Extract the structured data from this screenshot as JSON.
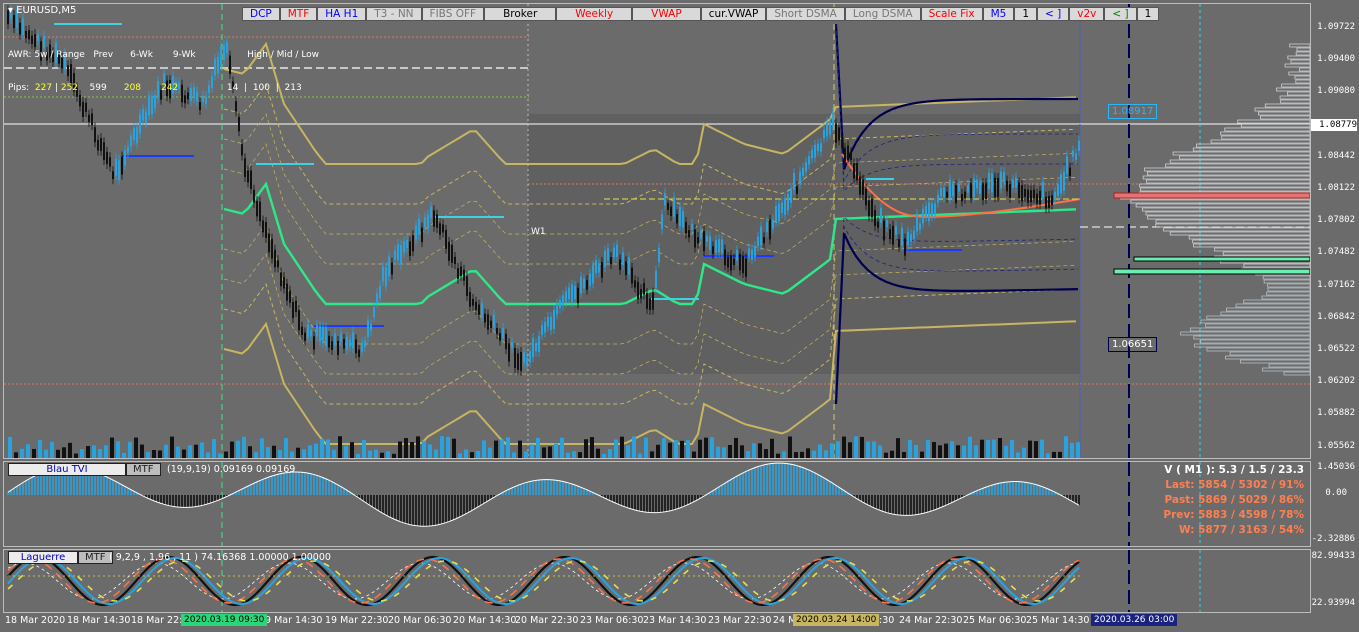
{
  "symbol": "EURUSD,M5",
  "toolbar": [
    {
      "label": "DCP",
      "color": "#0000ff"
    },
    {
      "label": "MTF",
      "color": "#ff0000"
    },
    {
      "label": "HA H1",
      "color": "#0000ff"
    },
    {
      "label": "T3 - NN",
      "color": "#777777"
    },
    {
      "label": "FIBS OFF",
      "color": "#777777"
    },
    {
      "label": "Broker",
      "color": "#000000"
    },
    {
      "label": "Weekly",
      "color": "#ff0000"
    },
    {
      "label": "VWAP",
      "color": "#ff0000"
    },
    {
      "label": "cur.VWAP",
      "color": "#000000"
    },
    {
      "label": "Short DSMA",
      "color": "#777777"
    },
    {
      "label": "Long DSMA",
      "color": "#777777"
    },
    {
      "label": "Scale Fix",
      "color": "#ff0000"
    },
    {
      "label": "M5",
      "color": "#0000ff"
    },
    {
      "label": "1",
      "color": "#000000"
    },
    {
      "label": "< ]",
      "color": "#0000ff"
    },
    {
      "label": "v2v",
      "color": "#ff0000"
    },
    {
      "label": "< ]",
      "color": "#008000"
    },
    {
      "label": "1",
      "color": "#000000"
    }
  ],
  "awr": {
    "line1": "AWR: 5w / Range   Prev      6-Wk       9-Wk                  High / Mid / Low",
    "pips_label": "Pips:",
    "v1": "227",
    "v2": "252",
    "v3": "599",
    "v4": "208",
    "v5": "242",
    "hml": "14  |  100  |  213"
  },
  "w1_label": "W1",
  "price_axis": [
    "1.09722",
    "1.09400",
    "1.09080",
    "1.08779",
    "1.08442",
    "1.08122",
    "1.07802",
    "1.07482",
    "1.07162",
    "1.06842",
    "1.06522",
    "1.06202",
    "1.05882",
    "1.05562"
  ],
  "current_price": "1.08779",
  "price_boxes": {
    "upper": "1.08917",
    "lower": "1.06651"
  },
  "tvi": {
    "name": "Blau TVI",
    "mtf": "MTF",
    "params": "(19,9,19) 0.09169 0.09169",
    "scale_top": "1.45036",
    "scale_mid": "0.00",
    "scale_bot": "-2.32886"
  },
  "laguerre": {
    "name": "Laguerre",
    "mtf": "MTF",
    "params": "( 9,2,9 , 1.96 , 11 ) 74.16368 1.00000 1.00000",
    "scale_top": "82.99433",
    "scale_bot": "22.93994"
  },
  "stats": {
    "title": "V ( M1 ): 5.3 / 1.5 / 23.3",
    "last": "Last: 5854 / 5302 / 91%",
    "past": "Past: 5869 / 5029 / 86%",
    "prev": "Prev: 5883 / 4598 / 78%",
    "w": "W: 5877 / 3163 / 54%"
  },
  "xaxis": [
    "18 Mar 2020",
    "18 Mar 14:30",
    "18 Mar 22:3",
    "19 Mar 14:30",
    "19 Mar 22:30",
    "20 Mar 06:30",
    "20 Mar 14:30",
    "20 Mar 22:30",
    "23 Mar 06:30",
    "23 Mar 14:30",
    "23 Mar 22:30",
    "24 M",
    "4:30",
    "24 Mar 22:30",
    "25 Mar 06:30",
    "25 Mar 14:30"
  ],
  "xaxis_highlights": {
    "green": "2020.03.19 09:30",
    "yellow": "2020.03.24 14:00",
    "blue": "2020.03.26 03:00"
  }
}
